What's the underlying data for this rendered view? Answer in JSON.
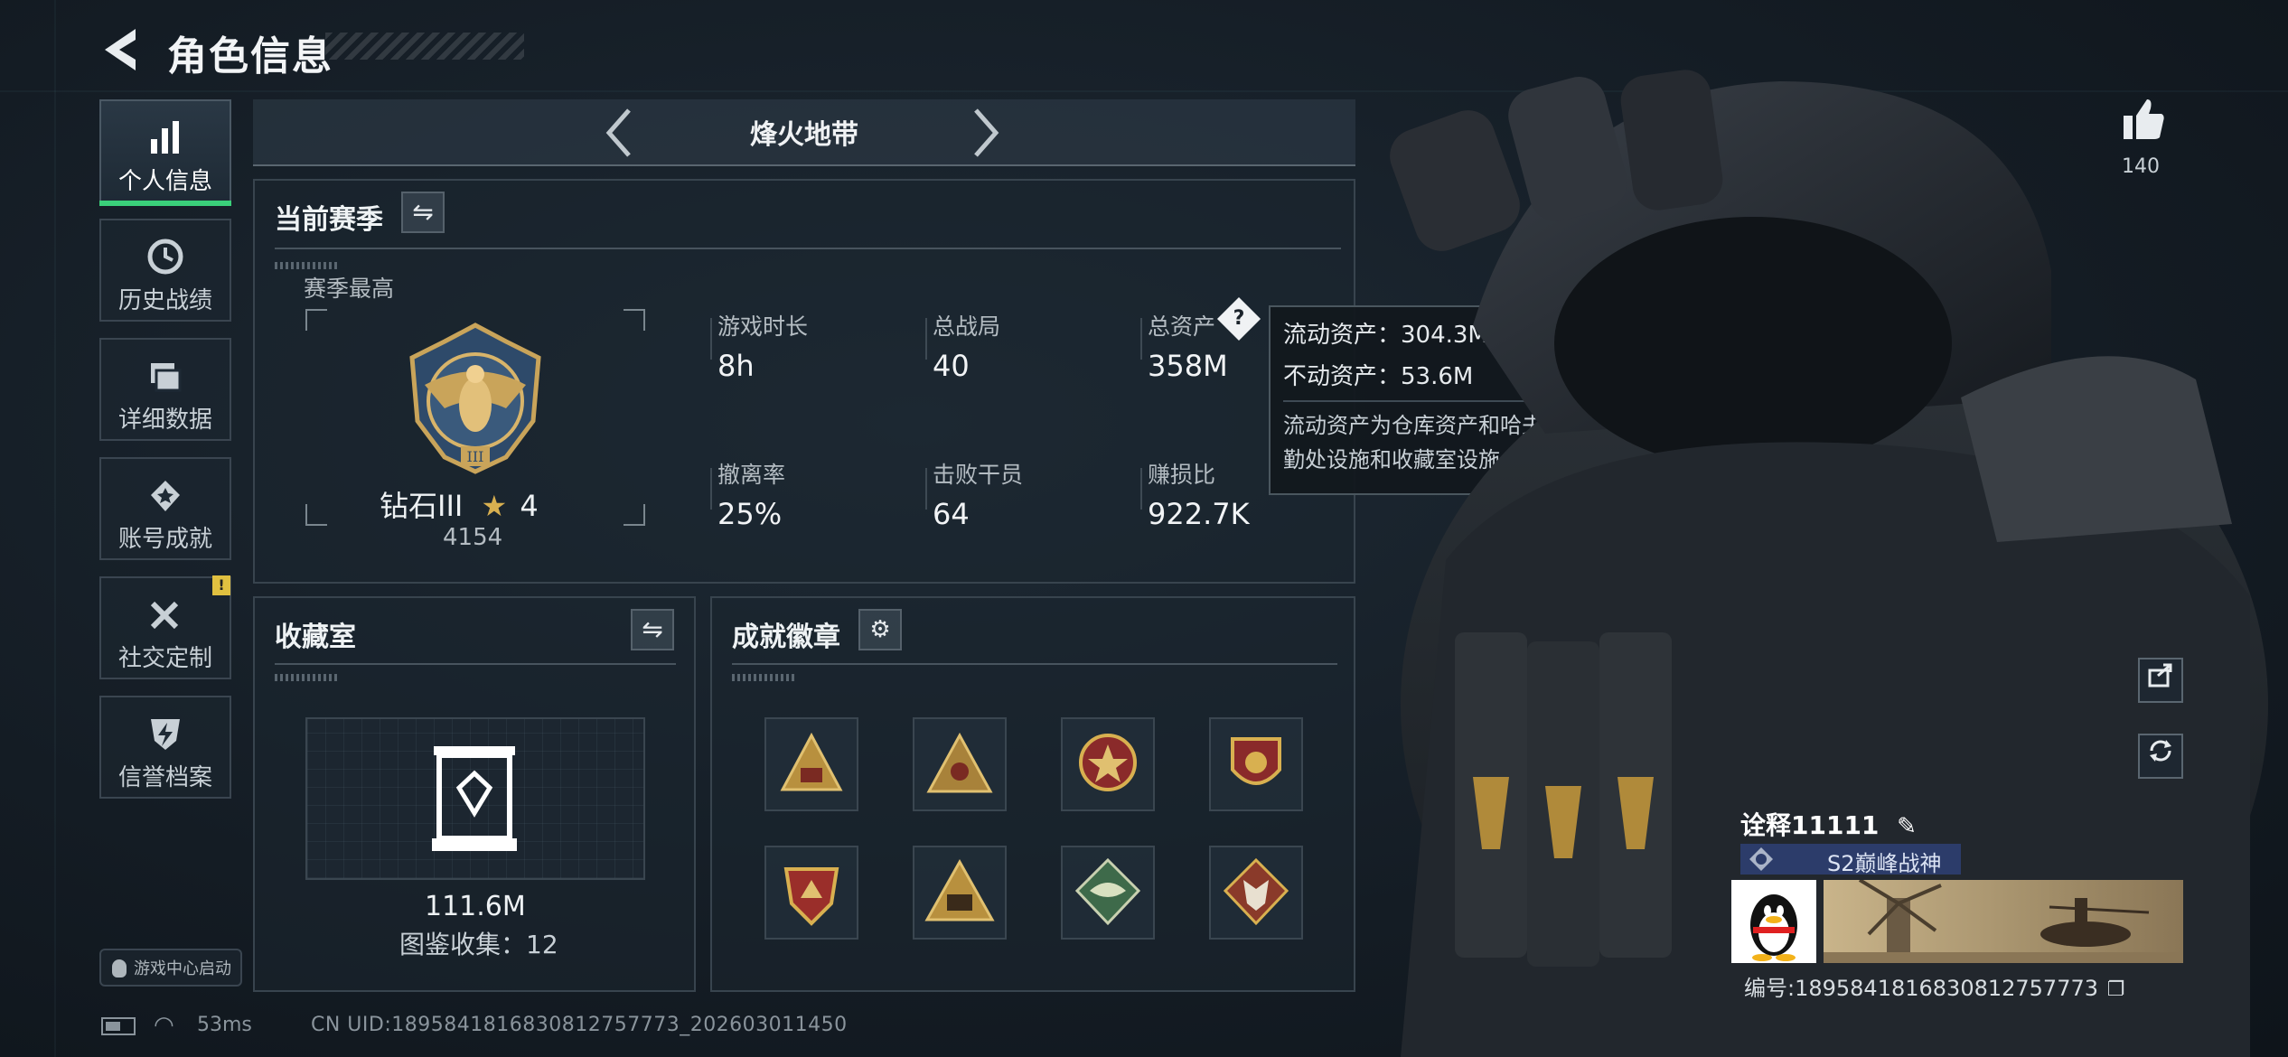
{
  "header": {
    "title": "角色信息"
  },
  "sidebar": {
    "items": [
      {
        "label": "个人信息",
        "icon": "bar-chart-icon",
        "active": true
      },
      {
        "label": "历史战绩",
        "icon": "history-icon"
      },
      {
        "label": "详细数据",
        "icon": "folder-icon"
      },
      {
        "label": "账号成就",
        "icon": "achievement-icon"
      },
      {
        "label": "社交定制",
        "icon": "tools-icon",
        "badge": "!"
      },
      {
        "label": "信誉档案",
        "icon": "credit-icon"
      }
    ],
    "game_center": "游戏中心启动"
  },
  "mode": {
    "name": "烽火地带"
  },
  "season": {
    "title": "当前赛季",
    "best_label": "赛季最高",
    "rank_name": "钻石III",
    "rank_stars": "4",
    "rank_score": "4154",
    "stats": [
      {
        "label": "游戏时长",
        "value": "8h"
      },
      {
        "label": "总战局",
        "value": "40"
      },
      {
        "label": "总资产",
        "value": "358M"
      },
      {
        "label": "撤离率",
        "value": "25%"
      },
      {
        "label": "击败干员",
        "value": "64"
      },
      {
        "label": "赚损比",
        "value": "922.7K"
      }
    ]
  },
  "tooltip": {
    "liquid": "流动资产：304.3M",
    "fixed": "不动资产：53.6M",
    "note": "流动资产为仓库资产和哈夫币，不动资产为特勤处设施和收藏室设施"
  },
  "collection": {
    "title": "收藏室",
    "value": "111.6M",
    "count": "图鉴收集：12"
  },
  "badges": {
    "title": "成就徽章"
  },
  "profile": {
    "likes": "140",
    "player_name": "诠释11111",
    "title_badge": "S2巅峰战神",
    "serial": "编号:1895841816830812757773"
  },
  "status": {
    "ping": "53ms",
    "uid": "CN UID:1895841816830812757773_202603011450"
  }
}
